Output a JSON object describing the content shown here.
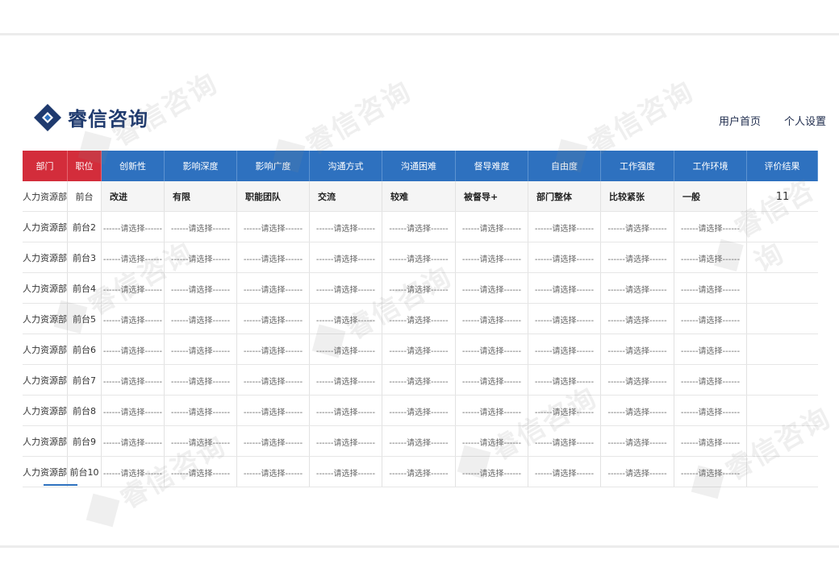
{
  "brand": {
    "name": "睿信咨询",
    "colors": {
      "blue": "#2e71bf",
      "red": "#d32d3b",
      "logo": "#1f3a6e"
    }
  },
  "nav": {
    "home": "用户首页",
    "settings": "个人设置"
  },
  "table": {
    "headers": [
      "部门",
      "职位",
      "创新性",
      "影响深度",
      "影响广度",
      "沟通方式",
      "沟通困难",
      "督导难度",
      "自由度",
      "工作强度",
      "工作环境",
      "评价结果"
    ],
    "rows": [
      {
        "dept": "人力资源部",
        "position": "前台",
        "values": [
          "改进",
          "有限",
          "职能团队",
          "交流",
          "较难",
          "被督导+",
          "部门整体",
          "比较紧张",
          "一般"
        ],
        "result": "11"
      },
      {
        "dept": "人力资源部",
        "position": "前台2",
        "values": [
          "------请选择------",
          "------请选择------",
          "------请选择------",
          "------请选择------",
          "------请选择------",
          "------请选择------",
          "------请选择------",
          "------请选择------",
          "------请选择------"
        ],
        "result": ""
      },
      {
        "dept": "人力资源部",
        "position": "前台3",
        "values": [
          "------请选择------",
          "------请选择------",
          "------请选择------",
          "------请选择------",
          "------请选择------",
          "------请选择------",
          "------请选择------",
          "------请选择------",
          "------请选择------"
        ],
        "result": ""
      },
      {
        "dept": "人力资源部",
        "position": "前台4",
        "values": [
          "------请选择------",
          "------请选择------",
          "------请选择------",
          "------请选择------",
          "------请选择------",
          "------请选择------",
          "------请选择------",
          "------请选择------",
          "------请选择------"
        ],
        "result": ""
      },
      {
        "dept": "人力资源部",
        "position": "前台5",
        "values": [
          "------请选择------",
          "------请选择------",
          "------请选择------",
          "------请选择------",
          "------请选择------",
          "------请选择------",
          "------请选择------",
          "------请选择------",
          "------请选择------"
        ],
        "result": ""
      },
      {
        "dept": "人力资源部",
        "position": "前台6",
        "values": [
          "------请选择------",
          "------请选择------",
          "------请选择------",
          "------请选择------",
          "------请选择------",
          "------请选择------",
          "------请选择------",
          "------请选择------",
          "------请选择------"
        ],
        "result": ""
      },
      {
        "dept": "人力资源部",
        "position": "前台7",
        "values": [
          "------请选择------",
          "------请选择------",
          "------请选择------",
          "------请选择------",
          "------请选择------",
          "------请选择------",
          "------请选择------",
          "------请选择------",
          "------请选择------"
        ],
        "result": ""
      },
      {
        "dept": "人力资源部",
        "position": "前台8",
        "values": [
          "------请选择------",
          "------请选择------",
          "------请选择------",
          "------请选择------",
          "------请选择------",
          "------请选择------",
          "------请选择------",
          "------请选择------",
          "------请选择------"
        ],
        "result": ""
      },
      {
        "dept": "人力资源部",
        "position": "前台9",
        "values": [
          "------请选择------",
          "------请选择------",
          "------请选择------",
          "------请选择------",
          "------请选择------",
          "------请选择------",
          "------请选择------",
          "------请选择------",
          "------请选择------"
        ],
        "result": ""
      },
      {
        "dept": "人力资源部",
        "position": "前台10",
        "values": [
          "------请选择------",
          "------请选择------",
          "------请选择------",
          "------请选择------",
          "------请选择------",
          "------请选择------",
          "------请选择------",
          "------请选择------",
          "------请选择------"
        ],
        "result": ""
      }
    ]
  }
}
